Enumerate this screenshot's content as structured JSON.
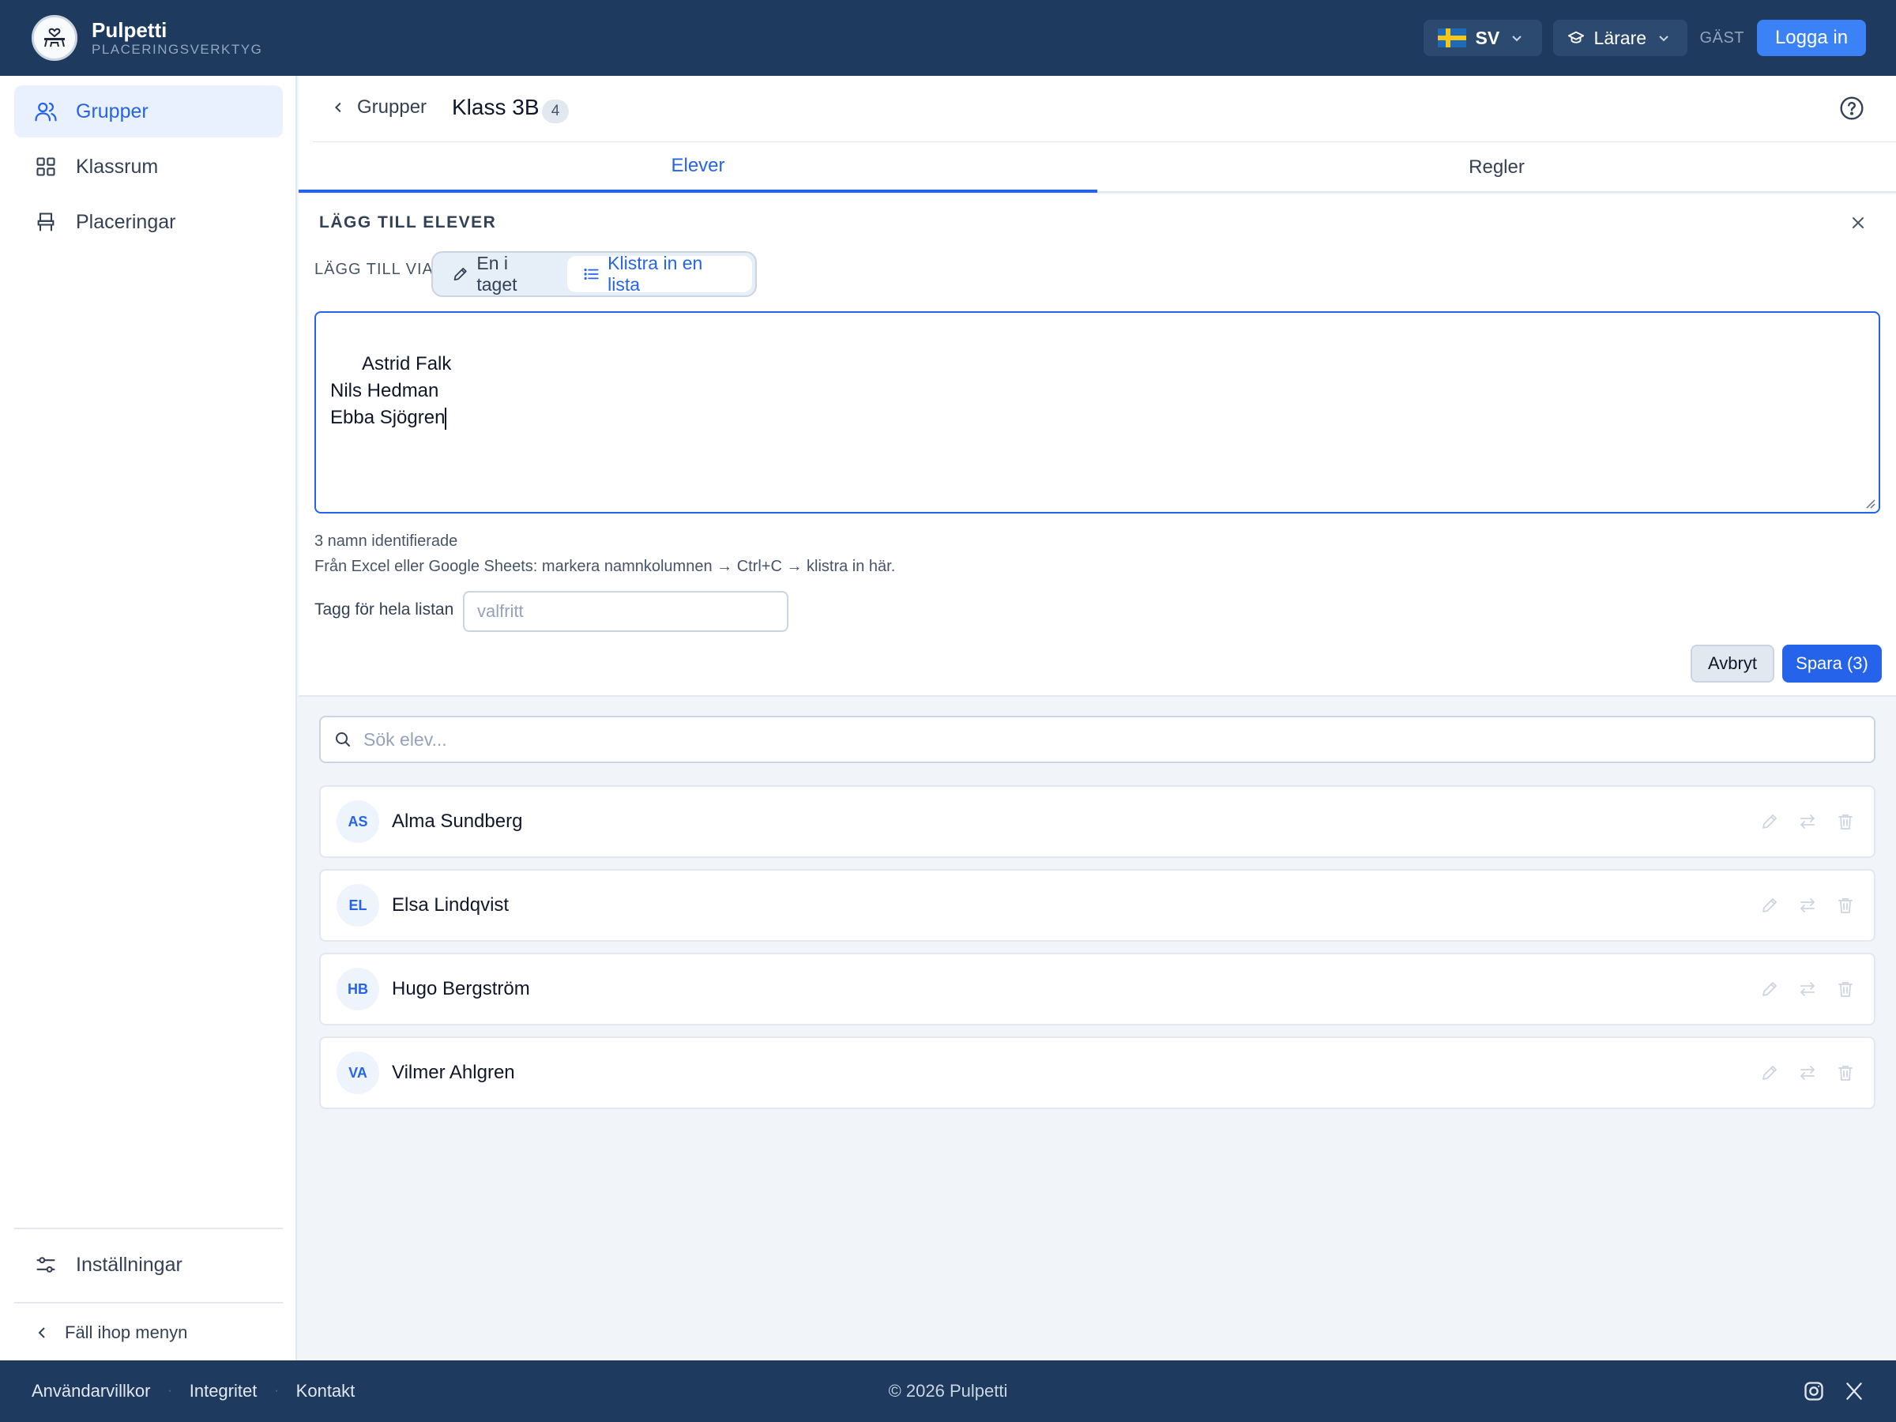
{
  "header": {
    "brand_name": "Pulpetti",
    "brand_sub": "PLACERINGSVERKTYG",
    "language": "SV",
    "role": "Lärare",
    "guest": "GÄST",
    "login": "Logga in"
  },
  "sidebar": {
    "items": [
      {
        "label": "Grupper",
        "icon": "users-icon",
        "active": true
      },
      {
        "label": "Klassrum",
        "icon": "grid-icon",
        "active": false
      },
      {
        "label": "Placeringar",
        "icon": "seat-icon",
        "active": false
      }
    ],
    "settings": "Inställningar",
    "collapse": "Fäll ihop menyn"
  },
  "topbar": {
    "back_label": "Grupper",
    "group_name": "Klass 3B",
    "count": "4"
  },
  "tabs": [
    {
      "label": "Elever",
      "active": true
    },
    {
      "label": "Regler",
      "active": false
    }
  ],
  "add_panel": {
    "title": "LÄGG TILL ELEVER",
    "via_label": "LÄGG TILL VIA",
    "mode_one": "En i taget",
    "mode_paste": "Klistra in en lista",
    "paste_value": "Astrid Falk\nNils Hedman\nEbba Sjögren",
    "identified": "3 namn identifierade",
    "hint": "Från Excel eller Google Sheets: markera namnkolumnen → Ctrl+C → klistra in här.",
    "tag_label": "Tagg för hela listan",
    "tag_placeholder": "valfritt",
    "cancel": "Avbryt",
    "save": "Spara (3)"
  },
  "search": {
    "placeholder": "Sök elev..."
  },
  "students": [
    {
      "initials": "AS",
      "name": "Alma Sundberg"
    },
    {
      "initials": "EL",
      "name": "Elsa Lindqvist"
    },
    {
      "initials": "HB",
      "name": "Hugo Bergström"
    },
    {
      "initials": "VA",
      "name": "Vilmer Ahlgren"
    }
  ],
  "footer": {
    "links": [
      "Användarvillkor",
      "Integritet",
      "Kontakt"
    ],
    "copyright": "© 2026 Pulpetti"
  },
  "colors": {
    "header_bg": "#1e3a5f",
    "accent": "#2563eb",
    "login_bg": "#3b82f6"
  }
}
